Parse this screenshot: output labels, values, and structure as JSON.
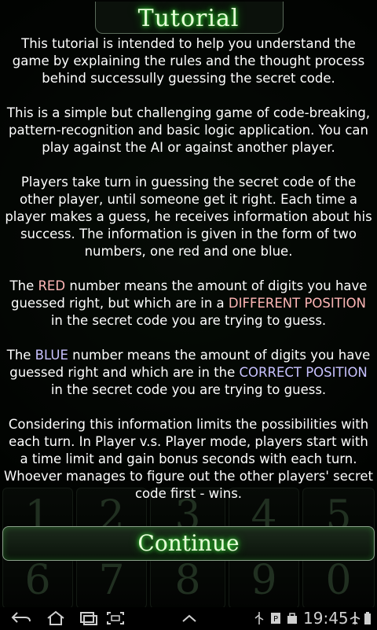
{
  "title": "Tutorial",
  "paragraphs": {
    "p1": "This tutorial is intended to help you understand the game by explaining the rules and the thought process behind successully guessing the secret code.",
    "p2": "This is a simple but challenging game of code-breaking, pattern-recognition and basic logic application. You can play against the AI or against another player.",
    "p3": "Players take turn in guessing the secret code of the other player, until someone get it right. Each time a player makes a guess, he receives information about his success. The information is given in the form of two numbers, one red and one blue.",
    "p4": {
      "a": "The ",
      "red": "RED",
      "b": " number means the amount of digits you have guessed right, but which are in a ",
      "diff": "DIFFERENT POSITION",
      "c": " in the secret code you are trying to guess."
    },
    "p5": {
      "a": "The ",
      "blue": "BLUE",
      "b": " number means the amount of digits you have guessed right and which are in the ",
      "correct": "CORRECT POSITION",
      "c": " in the secret code you are trying to guess."
    },
    "p6": "Considering this information limits the possibilities with each turn. In Player v.s. Player mode, players start with a time limit and gain bonus seconds with each turn. Whoever manages to figure out the other players' secret code first - wins."
  },
  "continue_label": "Continue",
  "keypad_row1": [
    "1",
    "2",
    "3",
    "4",
    "5"
  ],
  "keypad_row2": [
    "6",
    "7",
    "8",
    "9",
    "0"
  ],
  "status_bar": {
    "time": "19:45"
  },
  "colors": {
    "red_text": "#ffb6b6",
    "blue_text": "#c8c2ff",
    "glow": "#3cff3c"
  }
}
